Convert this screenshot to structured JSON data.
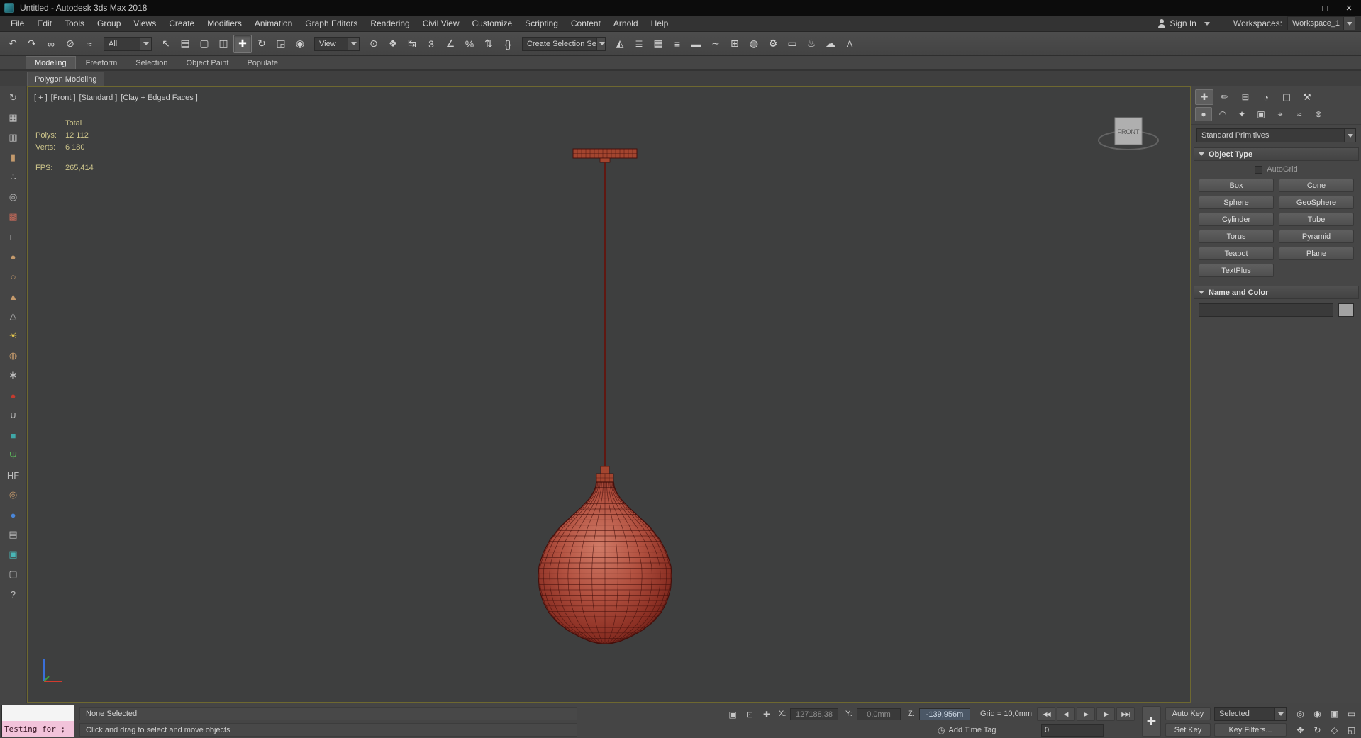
{
  "titlebar": {
    "title": "Untitled - Autodesk 3ds Max 2018",
    "minimize": "–",
    "maximize": "□",
    "close": "×"
  },
  "menubar": {
    "items": [
      "File",
      "Edit",
      "Tools",
      "Group",
      "Views",
      "Create",
      "Modifiers",
      "Animation",
      "Graph Editors",
      "Rendering",
      "Civil View",
      "Customize",
      "Scripting",
      "Content",
      "Arnold",
      "Help"
    ],
    "sign_in": "Sign In",
    "workspaces_label": "Workspaces:",
    "workspace_value": "Workspace_1"
  },
  "toolbar": {
    "filter_value": "All",
    "coord_value": "View",
    "selection_set_value": "Create Selection Se",
    "group_a": [
      {
        "name": "undo-button",
        "glyph": "↶"
      },
      {
        "name": "redo-button",
        "glyph": "↷"
      },
      {
        "name": "select-and-link-button",
        "glyph": "∞"
      },
      {
        "name": "unlink-selection-button",
        "glyph": "⊘"
      },
      {
        "name": "bind-to-space-warp-button",
        "glyph": "≈"
      }
    ],
    "group_b": [
      {
        "name": "select-object-button",
        "glyph": "↖"
      },
      {
        "name": "select-by-name-button",
        "glyph": "▤"
      },
      {
        "name": "rectangular-selection-region-button",
        "glyph": "▢"
      },
      {
        "name": "window-crossing-toggle-button",
        "glyph": "◫"
      },
      {
        "name": "select-and-move-button",
        "glyph": "✚",
        "active": true
      },
      {
        "name": "select-and-rotate-button",
        "glyph": "↻"
      },
      {
        "name": "select-and-scale-button",
        "glyph": "◲"
      },
      {
        "name": "select-and-place-button",
        "glyph": "◉"
      }
    ],
    "group_c": [
      {
        "name": "use-pivot-point-center-button",
        "glyph": "⊙"
      },
      {
        "name": "select-and-manipulate-button",
        "glyph": "❖"
      },
      {
        "name": "keyboard-shortcut-override-button",
        "glyph": "↹"
      },
      {
        "name": "snaps-toggle-button",
        "glyph": "3"
      },
      {
        "name": "angle-snap-toggle-button",
        "glyph": "∠"
      },
      {
        "name": "percent-snap-toggle-button",
        "glyph": "%"
      },
      {
        "name": "spinner-snap-toggle-button",
        "glyph": "⇅"
      },
      {
        "name": "edit-named-selection-sets-button",
        "glyph": "{}"
      }
    ],
    "group_d": [
      {
        "name": "mirror-button",
        "glyph": "◭"
      },
      {
        "name": "align-button",
        "glyph": "≣"
      },
      {
        "name": "scene-explorer-toggle-button",
        "glyph": "▦"
      },
      {
        "name": "layer-explorer-toggle-button",
        "glyph": "≡"
      },
      {
        "name": "ribbon-toggle-button",
        "glyph": "▬"
      },
      {
        "name": "curve-editor-button",
        "glyph": "∼"
      },
      {
        "name": "schematic-view-button",
        "glyph": "⊞"
      },
      {
        "name": "material-editor-button",
        "glyph": "◍"
      },
      {
        "name": "render-setup-button",
        "glyph": "⚙"
      },
      {
        "name": "rendered-frame-window-button",
        "glyph": "▭"
      },
      {
        "name": "render-production-button",
        "glyph": "♨"
      },
      {
        "name": "render-a360-button",
        "glyph": "☁"
      },
      {
        "name": "arnold-renderview-button",
        "glyph": "A"
      }
    ]
  },
  "ribbon": {
    "tabs": [
      {
        "name": "ribbon-tab-modeling",
        "label": "Modeling",
        "active": true
      },
      {
        "name": "ribbon-tab-freeform",
        "label": "Freeform"
      },
      {
        "name": "ribbon-tab-selection",
        "label": "Selection"
      },
      {
        "name": "ribbon-tab-object-paint",
        "label": "Object Paint"
      },
      {
        "name": "ribbon-tab-populate",
        "label": "Populate"
      }
    ],
    "subtab": "Polygon Modeling"
  },
  "left_toolbar": {
    "items": [
      {
        "name": "view-rotate-tool",
        "glyph": "↻",
        "color": "#bdbdbd"
      },
      {
        "name": "grid-tool",
        "glyph": "▦",
        "color": "#bdbdbd"
      },
      {
        "name": "spreadsheet-tool",
        "glyph": "▥",
        "color": "#bdbdbd"
      },
      {
        "name": "cylinder-tool",
        "glyph": "▮",
        "color": "#c49a6c"
      },
      {
        "name": "spray-tool",
        "glyph": "∴",
        "color": "#bdbdbd"
      },
      {
        "name": "swirl-tool",
        "glyph": "◎",
        "color": "#bdbdbd"
      },
      {
        "name": "palette-tool",
        "glyph": "▩",
        "color": "#c46a5a"
      },
      {
        "name": "box-tool",
        "glyph": "□",
        "color": "#d8d8d8"
      },
      {
        "name": "sphere-tool",
        "glyph": "●",
        "color": "#c49a6c"
      },
      {
        "name": "circle-tool",
        "glyph": "○",
        "color": "#c49a6c"
      },
      {
        "name": "cone-tool",
        "glyph": "▲",
        "color": "#c49a6c"
      },
      {
        "name": "pyramid-tool",
        "glyph": "△",
        "color": "#bdbdbd"
      },
      {
        "name": "sun-light-tool",
        "glyph": "☀",
        "color": "#e6c84e"
      },
      {
        "name": "geosphere-tool",
        "glyph": "◍",
        "color": "#c49a6c"
      },
      {
        "name": "particles-tool",
        "glyph": "✱",
        "color": "#bdbdbd"
      },
      {
        "name": "red-sphere-tool",
        "glyph": "●",
        "color": "#c43b2e"
      },
      {
        "name": "magnet-tool",
        "glyph": "∪",
        "color": "#bdbdbd"
      },
      {
        "name": "teal-cube-tool",
        "glyph": "■",
        "color": "#3fa8a8"
      },
      {
        "name": "foliage-tool",
        "glyph": "Ψ",
        "color": "#5cb85c"
      },
      {
        "name": "hf-tool",
        "glyph": "HF",
        "color": "#bdbdbd"
      },
      {
        "name": "torus-tool",
        "glyph": "◎",
        "color": "#c49a6c"
      },
      {
        "name": "blue-sphere-tool",
        "glyph": "●",
        "color": "#4a86d8"
      },
      {
        "name": "clipboard-tool",
        "glyph": "▤",
        "color": "#bdbdbd"
      },
      {
        "name": "teal-panel-tool",
        "glyph": "▣",
        "color": "#49b6b6"
      },
      {
        "name": "monitor-tool",
        "glyph": "▢",
        "color": "#bdbdbd"
      },
      {
        "name": "help-tool",
        "glyph": "?",
        "color": "#bdbdbd"
      }
    ]
  },
  "viewport": {
    "label_segments": [
      "[ + ]",
      "[Front ]",
      "[Standard ]",
      "[Clay + Edged Faces ]"
    ],
    "stats": {
      "total_label": "Total",
      "polys_label": "Polys:",
      "polys": "12 112",
      "verts_label": "Verts:",
      "verts": "6 180",
      "fps_label": "FPS:",
      "fps": "265,414"
    },
    "viewcube_label": "FRONT",
    "lamp": {
      "body_light": "#d17b67",
      "body_mid": "#b25140",
      "body_dark": "#651c15",
      "edge": "#44100c",
      "metal": "#a3452f",
      "rod": "#5f1812"
    }
  },
  "command_panel": {
    "tabs": [
      {
        "name": "create-tab",
        "glyph": "✚",
        "active": true
      },
      {
        "name": "modify-tab",
        "glyph": "✏"
      },
      {
        "name": "hierarchy-tab",
        "glyph": "⊟"
      },
      {
        "name": "motion-tab",
        "glyph": "◔"
      },
      {
        "name": "display-tab",
        "glyph": "▢"
      },
      {
        "name": "utilities-tab",
        "glyph": "⚒"
      }
    ],
    "categories": [
      {
        "name": "geometry-category",
        "glyph": "●",
        "active": true
      },
      {
        "name": "shapes-category",
        "glyph": "◠"
      },
      {
        "name": "lights-category",
        "glyph": "✦"
      },
      {
        "name": "cameras-category",
        "glyph": "▣"
      },
      {
        "name": "helpers-category",
        "glyph": "⌖"
      },
      {
        "name": "space-warps-category",
        "glyph": "≈"
      },
      {
        "name": "systems-category",
        "glyph": "⊛"
      }
    ],
    "primitives_dropdown_value": "Standard Primitives",
    "object_type_title": "Object Type",
    "autogrid_label": "AutoGrid",
    "object_type_buttons": [
      "Box",
      "Cone",
      "Sphere",
      "GeoSphere",
      "Cylinder",
      "Tube",
      "Torus",
      "Pyramid",
      "Teapot",
      "Plane",
      "TextPlus"
    ],
    "name_color_title": "Name and Color"
  },
  "statusbar": {
    "listener_text": "Testing for ;",
    "selection_text": "None Selected",
    "prompt_text": "Click and drag to select and move objects",
    "pre_icons": [
      {
        "name": "isolate-selection-toggle",
        "glyph": "▣"
      },
      {
        "name": "selection-lock-toggle",
        "glyph": "⊡"
      },
      {
        "name": "absolute-offset-mode-toggle",
        "glyph": "✚"
      }
    ],
    "x_label": "X:",
    "x_value": "127188,38",
    "y_label": "Y:",
    "y_value": "0,0mm",
    "z_label": "Z:",
    "z_value": "-139,956m",
    "grid_text": "Grid = 10,0mm",
    "time_tag_icon": "◷",
    "add_time_tag": "Add Time Tag",
    "playback": [
      {
        "name": "go-to-start-button",
        "glyph": "|◀◀"
      },
      {
        "name": "previous-frame-button",
        "glyph": "◀|"
      },
      {
        "name": "play-button",
        "glyph": "▶"
      },
      {
        "name": "next-frame-button",
        "glyph": "|▶"
      },
      {
        "name": "go-to-end-button",
        "glyph": "▶▶|"
      }
    ],
    "plus_glyph": "✚",
    "auto_key": "Auto Key",
    "set_key": "Set Key",
    "selected_value": "Selected",
    "key_filters": "Key Filters...",
    "frame_value": "0",
    "nav_row1": [
      {
        "name": "zoom-button",
        "glyph": "◎"
      },
      {
        "name": "zoom-all-button",
        "glyph": "◉"
      },
      {
        "name": "zoom-extents-button",
        "glyph": "▣"
      },
      {
        "name": "zoom-region-button",
        "glyph": "▭"
      }
    ],
    "nav_row2": [
      {
        "name": "pan-button",
        "glyph": "✥"
      },
      {
        "name": "orbit-button",
        "glyph": "↻"
      },
      {
        "name": "field-of-view-button",
        "glyph": "◇"
      },
      {
        "name": "maximize-viewport-toggle",
        "glyph": "◱"
      }
    ]
  }
}
